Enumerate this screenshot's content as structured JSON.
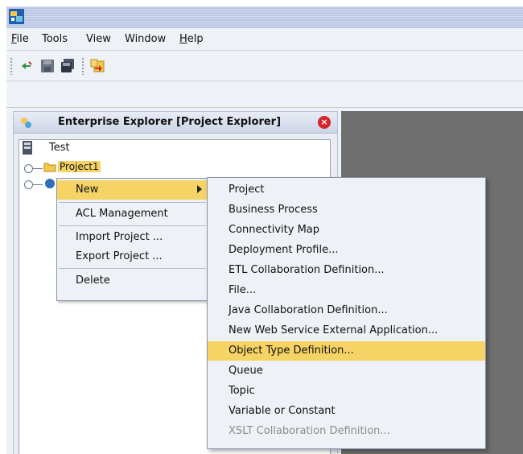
{
  "menubar": {
    "items": [
      {
        "label": "File",
        "underline": "F",
        "rest": "ile"
      },
      {
        "label": "Tools"
      },
      {
        "label": "View"
      },
      {
        "label": "Window"
      },
      {
        "label": "Help",
        "underline": "H",
        "rest": "elp"
      }
    ]
  },
  "toolbar": {
    "icons": [
      "refresh-icon",
      "save-icon",
      "save-all-icon",
      "import-icon"
    ]
  },
  "panel": {
    "title": "Enterprise Explorer [Project Explorer]",
    "icon": "explorer-icon",
    "close_icon": "×"
  },
  "tree": {
    "root_label": "Test",
    "project_label": "Project1"
  },
  "context_menu": {
    "items": [
      {
        "label": "New",
        "submenu": true,
        "selected": true
      },
      {
        "label": "ACL Management"
      },
      {
        "label": "Import Project ..."
      },
      {
        "label": "Export Project ..."
      },
      {
        "label": "Delete"
      }
    ]
  },
  "submenu": {
    "items": [
      {
        "label": "Project"
      },
      {
        "label": "Business Process"
      },
      {
        "label": "Connectivity Map"
      },
      {
        "label": "Deployment Profile..."
      },
      {
        "label": "ETL Collaboration Definition..."
      },
      {
        "label": "File..."
      },
      {
        "label": "Java Collaboration Definition..."
      },
      {
        "label": "New Web Service External Application..."
      },
      {
        "label": "Object Type Definition...",
        "selected": true
      },
      {
        "label": "Queue"
      },
      {
        "label": "Topic"
      },
      {
        "label": "Variable or Constant"
      },
      {
        "label": "XSLT Collaboration Definition...",
        "disabled": true
      }
    ]
  },
  "colors": {
    "highlight": "#f6d365",
    "close_button": "#d5252d",
    "right_area": "#6f6f6f"
  }
}
